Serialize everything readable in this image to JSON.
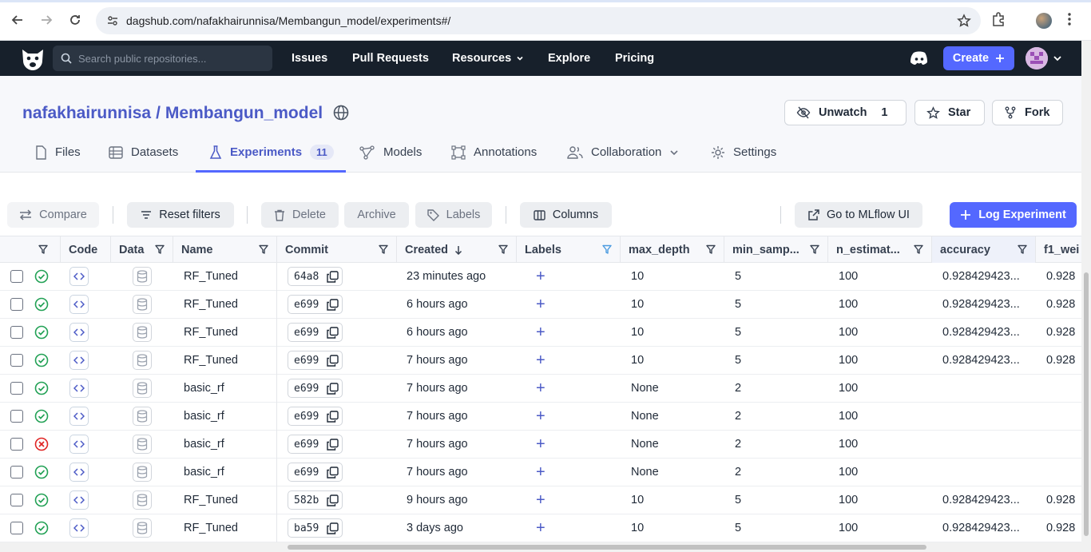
{
  "browser": {
    "url": "dagshub.com/nafakhairunnisa/Membangun_model/experiments#/"
  },
  "header": {
    "search_placeholder": "Search public repositories...",
    "nav": [
      "Issues",
      "Pull Requests",
      "Resources",
      "Explore",
      "Pricing"
    ],
    "create_label": "Create"
  },
  "repo": {
    "owner": "nafakhairunnisa",
    "separator": "/",
    "name": "Membangun_model",
    "unwatch_label": "Unwatch",
    "watch_count": "1",
    "star_label": "Star",
    "fork_label": "Fork",
    "tabs": [
      {
        "label": "Files"
      },
      {
        "label": "Datasets"
      },
      {
        "label": "Experiments",
        "badge": "11"
      },
      {
        "label": "Models"
      },
      {
        "label": "Annotations"
      },
      {
        "label": "Collaboration"
      },
      {
        "label": "Settings"
      }
    ]
  },
  "toolbar": {
    "compare": "Compare",
    "reset_filters": "Reset filters",
    "delete": "Delete",
    "archive": "Archive",
    "labels": "Labels",
    "columns": "Columns",
    "mlflow": "Go to MLflow UI",
    "log_experiment": "Log Experiment"
  },
  "table": {
    "columns": [
      "Code",
      "Data",
      "Name",
      "Commit",
      "Created",
      "Labels",
      "max_depth",
      "min_samp...",
      "n_estimat...",
      "accuracy",
      "f1_wei"
    ],
    "rows": [
      {
        "status": "success",
        "name": "RF_Tuned",
        "commit": "64a8",
        "created": "23 minutes ago",
        "max_depth": "10",
        "min_samples": "5",
        "n_estimators": "100",
        "accuracy": "0.928429423...",
        "f1": "0.928"
      },
      {
        "status": "success",
        "name": "RF_Tuned",
        "commit": "e699",
        "created": "6 hours ago",
        "max_depth": "10",
        "min_samples": "5",
        "n_estimators": "100",
        "accuracy": "0.928429423...",
        "f1": "0.928"
      },
      {
        "status": "success",
        "name": "RF_Tuned",
        "commit": "e699",
        "created": "6 hours ago",
        "max_depth": "10",
        "min_samples": "5",
        "n_estimators": "100",
        "accuracy": "0.928429423...",
        "f1": "0.928"
      },
      {
        "status": "success",
        "name": "RF_Tuned",
        "commit": "e699",
        "created": "7 hours ago",
        "max_depth": "10",
        "min_samples": "5",
        "n_estimators": "100",
        "accuracy": "0.928429423...",
        "f1": "0.928"
      },
      {
        "status": "success",
        "name": "basic_rf",
        "commit": "e699",
        "created": "7 hours ago",
        "max_depth": "None",
        "min_samples": "2",
        "n_estimators": "100",
        "accuracy": "",
        "f1": ""
      },
      {
        "status": "success",
        "name": "basic_rf",
        "commit": "e699",
        "created": "7 hours ago",
        "max_depth": "None",
        "min_samples": "2",
        "n_estimators": "100",
        "accuracy": "",
        "f1": ""
      },
      {
        "status": "failed",
        "name": "basic_rf",
        "commit": "e699",
        "created": "7 hours ago",
        "max_depth": "None",
        "min_samples": "2",
        "n_estimators": "100",
        "accuracy": "",
        "f1": ""
      },
      {
        "status": "success",
        "name": "basic_rf",
        "commit": "e699",
        "created": "7 hours ago",
        "max_depth": "None",
        "min_samples": "2",
        "n_estimators": "100",
        "accuracy": "",
        "f1": ""
      },
      {
        "status": "success",
        "name": "RF_Tuned",
        "commit": "582b",
        "created": "9 hours ago",
        "max_depth": "10",
        "min_samples": "5",
        "n_estimators": "100",
        "accuracy": "0.928429423...",
        "f1": "0.928"
      },
      {
        "status": "success",
        "name": "RF_Tuned",
        "commit": "ba59",
        "created": "3 days ago",
        "max_depth": "10",
        "min_samples": "5",
        "n_estimators": "100",
        "accuracy": "0.928429423...",
        "f1": "0.928"
      }
    ]
  },
  "colors": {
    "accent": "#5468ff",
    "success": "#22a155",
    "failed": "#e02424",
    "header_bg": "#17202b"
  }
}
